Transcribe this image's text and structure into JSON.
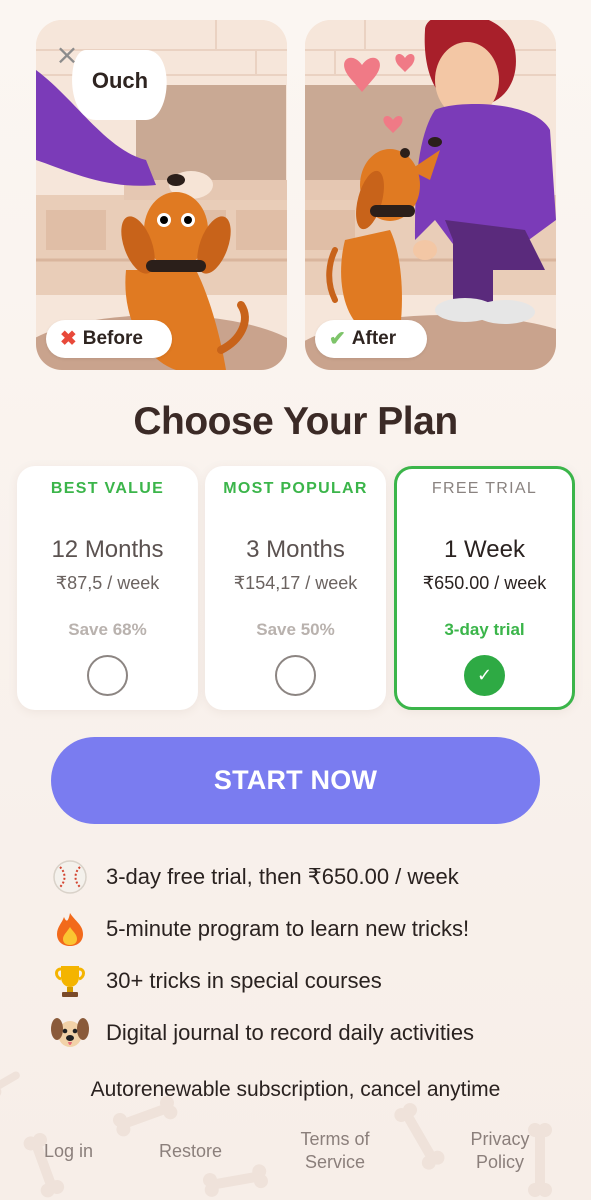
{
  "illustrations": {
    "before_speech": "Ouch",
    "before_label": "Before",
    "after_label": "After"
  },
  "title": "Choose Your Plan",
  "plans": [
    {
      "tag": "BEST VALUE",
      "duration": "12 Months",
      "price": "₹87,5 / week",
      "note": "Save 68%",
      "selected": false
    },
    {
      "tag": "MOST POPULAR",
      "duration": "3 Months",
      "price": "₹154,17 / week",
      "note": "Save 50%",
      "selected": false
    },
    {
      "tag": "FREE TRIAL",
      "duration": "1 Week",
      "price": "₹650.00 / week",
      "note": "3-day trial",
      "selected": true
    }
  ],
  "cta_label": "START NOW",
  "features": [
    {
      "icon": "baseball-icon",
      "text": "3-day free trial, then ₹650.00 / week"
    },
    {
      "icon": "fire-icon",
      "text": "5-minute program to learn new tricks!"
    },
    {
      "icon": "trophy-icon",
      "text": "30+ tricks in special courses"
    },
    {
      "icon": "dog-face-icon",
      "text": "Digital journal to record daily activities"
    }
  ],
  "autorenew_text": "Autorenewable subscription, cancel anytime",
  "footer": {
    "login": "Log in",
    "restore": "Restore",
    "terms_line1": "Terms of",
    "terms_line2": "Service",
    "privacy_line1": "Privacy",
    "privacy_line2": "Policy"
  },
  "colors": {
    "accent_green": "#3bb54a",
    "cta_purple": "#7a7cf0",
    "background": "#fbf6f2"
  }
}
